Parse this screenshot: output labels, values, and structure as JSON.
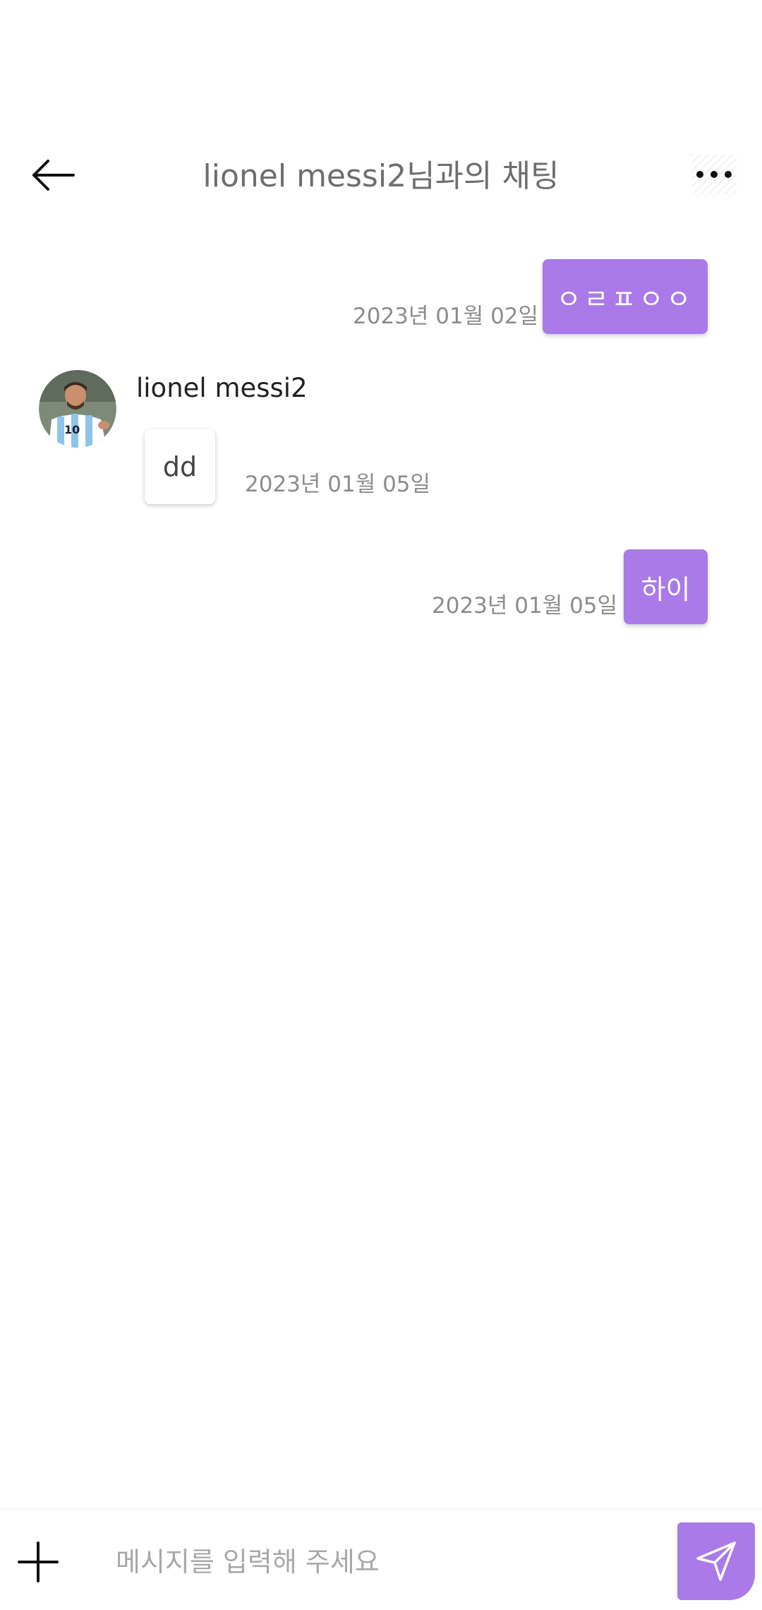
{
  "header": {
    "title": "lionel messi2님과의 채팅",
    "back_icon": "arrow-left-icon",
    "more_icon": "more-horizontal-icon"
  },
  "messages": [
    {
      "direction": "outgoing",
      "text": "ㅇㄹㅍㅇㅇ",
      "timestamp": "2023년 01월 02일"
    },
    {
      "direction": "incoming",
      "sender": "lionel messi2",
      "text": "dd",
      "timestamp": "2023년 01월 05일"
    },
    {
      "direction": "outgoing",
      "text": "하이",
      "timestamp": "2023년 01월 05일"
    }
  ],
  "composer": {
    "placeholder": "메시지를 입력해 주세요",
    "value": "",
    "add_icon": "plus-icon",
    "send_icon": "send-icon"
  },
  "colors": {
    "accent": "#a97ae8",
    "timestamp": "#8c8c8c",
    "title": "#6e6e6e"
  }
}
